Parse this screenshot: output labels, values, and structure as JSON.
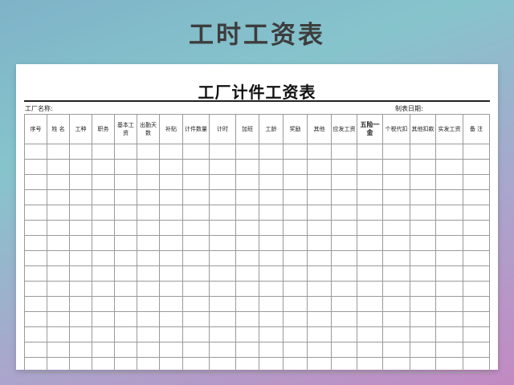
{
  "banner": {
    "title": "工时工资表"
  },
  "sheet": {
    "title": "工厂计件工资表",
    "factory_label": "工厂名称:",
    "date_label": "制表日期:"
  },
  "table": {
    "columns": [
      "序号",
      "姓 名",
      "工种",
      "职务",
      "基本工资",
      "出勤天数",
      "补贴",
      "计件数量",
      "计时",
      "加班",
      "工龄",
      "奖励",
      "其他",
      "应发工资",
      "五险一金",
      "个税代扣",
      "其他扣款",
      "实发工资",
      "备 注"
    ],
    "empty_row_count": 15
  }
}
